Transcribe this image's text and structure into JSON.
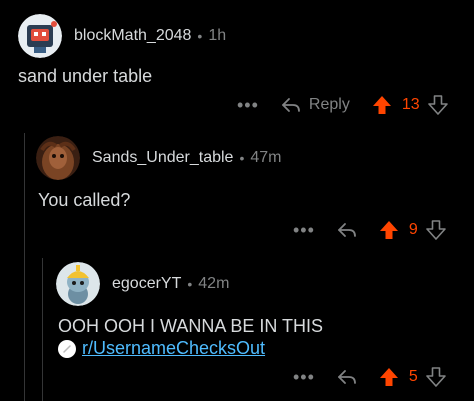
{
  "colors": {
    "background": "#000000",
    "text": "#d7dadc",
    "meta": "#818384",
    "upvote": "#ff4500",
    "link": "#4fbcff",
    "thread_line": "#343536"
  },
  "comments": [
    {
      "username": "blockMath_2048",
      "separator": "•",
      "time": "1h",
      "body": "sand under table",
      "actions": {
        "more": "•••",
        "reply_icon": "reply-arrow-icon",
        "reply_label": "Reply",
        "score": "13"
      }
    },
    {
      "username": "Sands_Under_table",
      "separator": "•",
      "time": "47m",
      "body": "You called?",
      "actions": {
        "more": "•••",
        "reply_icon": "reply-arrow-icon",
        "score": "9"
      }
    },
    {
      "username": "egocerYT",
      "separator": "•",
      "time": "42m",
      "body": "OOH OOH I WANNA BE IN THIS",
      "link": "r/UsernameChecksOut",
      "actions": {
        "more": "•••",
        "reply_icon": "reply-arrow-icon",
        "score": "5"
      }
    }
  ]
}
